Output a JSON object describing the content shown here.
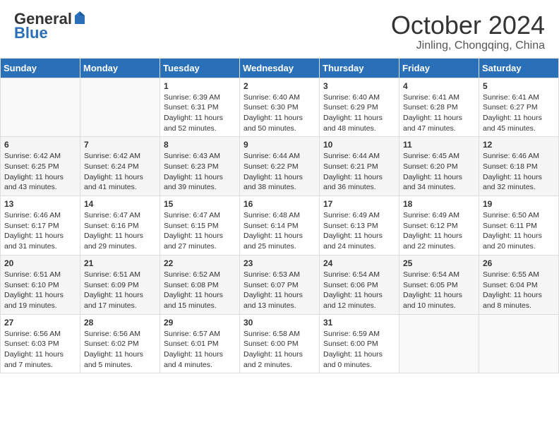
{
  "logo": {
    "general": "General",
    "blue": "Blue"
  },
  "title": "October 2024",
  "subtitle": "Jinling, Chongqing, China",
  "days_of_week": [
    "Sunday",
    "Monday",
    "Tuesday",
    "Wednesday",
    "Thursday",
    "Friday",
    "Saturday"
  ],
  "weeks": [
    [
      {
        "day": "",
        "info": ""
      },
      {
        "day": "",
        "info": ""
      },
      {
        "day": "1",
        "info": "Sunrise: 6:39 AM\nSunset: 6:31 PM\nDaylight: 11 hours and 52 minutes."
      },
      {
        "day": "2",
        "info": "Sunrise: 6:40 AM\nSunset: 6:30 PM\nDaylight: 11 hours and 50 minutes."
      },
      {
        "day": "3",
        "info": "Sunrise: 6:40 AM\nSunset: 6:29 PM\nDaylight: 11 hours and 48 minutes."
      },
      {
        "day": "4",
        "info": "Sunrise: 6:41 AM\nSunset: 6:28 PM\nDaylight: 11 hours and 47 minutes."
      },
      {
        "day": "5",
        "info": "Sunrise: 6:41 AM\nSunset: 6:27 PM\nDaylight: 11 hours and 45 minutes."
      }
    ],
    [
      {
        "day": "6",
        "info": "Sunrise: 6:42 AM\nSunset: 6:25 PM\nDaylight: 11 hours and 43 minutes."
      },
      {
        "day": "7",
        "info": "Sunrise: 6:42 AM\nSunset: 6:24 PM\nDaylight: 11 hours and 41 minutes."
      },
      {
        "day": "8",
        "info": "Sunrise: 6:43 AM\nSunset: 6:23 PM\nDaylight: 11 hours and 39 minutes."
      },
      {
        "day": "9",
        "info": "Sunrise: 6:44 AM\nSunset: 6:22 PM\nDaylight: 11 hours and 38 minutes."
      },
      {
        "day": "10",
        "info": "Sunrise: 6:44 AM\nSunset: 6:21 PM\nDaylight: 11 hours and 36 minutes."
      },
      {
        "day": "11",
        "info": "Sunrise: 6:45 AM\nSunset: 6:20 PM\nDaylight: 11 hours and 34 minutes."
      },
      {
        "day": "12",
        "info": "Sunrise: 6:46 AM\nSunset: 6:18 PM\nDaylight: 11 hours and 32 minutes."
      }
    ],
    [
      {
        "day": "13",
        "info": "Sunrise: 6:46 AM\nSunset: 6:17 PM\nDaylight: 11 hours and 31 minutes."
      },
      {
        "day": "14",
        "info": "Sunrise: 6:47 AM\nSunset: 6:16 PM\nDaylight: 11 hours and 29 minutes."
      },
      {
        "day": "15",
        "info": "Sunrise: 6:47 AM\nSunset: 6:15 PM\nDaylight: 11 hours and 27 minutes."
      },
      {
        "day": "16",
        "info": "Sunrise: 6:48 AM\nSunset: 6:14 PM\nDaylight: 11 hours and 25 minutes."
      },
      {
        "day": "17",
        "info": "Sunrise: 6:49 AM\nSunset: 6:13 PM\nDaylight: 11 hours and 24 minutes."
      },
      {
        "day": "18",
        "info": "Sunrise: 6:49 AM\nSunset: 6:12 PM\nDaylight: 11 hours and 22 minutes."
      },
      {
        "day": "19",
        "info": "Sunrise: 6:50 AM\nSunset: 6:11 PM\nDaylight: 11 hours and 20 minutes."
      }
    ],
    [
      {
        "day": "20",
        "info": "Sunrise: 6:51 AM\nSunset: 6:10 PM\nDaylight: 11 hours and 19 minutes."
      },
      {
        "day": "21",
        "info": "Sunrise: 6:51 AM\nSunset: 6:09 PM\nDaylight: 11 hours and 17 minutes."
      },
      {
        "day": "22",
        "info": "Sunrise: 6:52 AM\nSunset: 6:08 PM\nDaylight: 11 hours and 15 minutes."
      },
      {
        "day": "23",
        "info": "Sunrise: 6:53 AM\nSunset: 6:07 PM\nDaylight: 11 hours and 13 minutes."
      },
      {
        "day": "24",
        "info": "Sunrise: 6:54 AM\nSunset: 6:06 PM\nDaylight: 11 hours and 12 minutes."
      },
      {
        "day": "25",
        "info": "Sunrise: 6:54 AM\nSunset: 6:05 PM\nDaylight: 11 hours and 10 minutes."
      },
      {
        "day": "26",
        "info": "Sunrise: 6:55 AM\nSunset: 6:04 PM\nDaylight: 11 hours and 8 minutes."
      }
    ],
    [
      {
        "day": "27",
        "info": "Sunrise: 6:56 AM\nSunset: 6:03 PM\nDaylight: 11 hours and 7 minutes."
      },
      {
        "day": "28",
        "info": "Sunrise: 6:56 AM\nSunset: 6:02 PM\nDaylight: 11 hours and 5 minutes."
      },
      {
        "day": "29",
        "info": "Sunrise: 6:57 AM\nSunset: 6:01 PM\nDaylight: 11 hours and 4 minutes."
      },
      {
        "day": "30",
        "info": "Sunrise: 6:58 AM\nSunset: 6:00 PM\nDaylight: 11 hours and 2 minutes."
      },
      {
        "day": "31",
        "info": "Sunrise: 6:59 AM\nSunset: 6:00 PM\nDaylight: 11 hours and 0 minutes."
      },
      {
        "day": "",
        "info": ""
      },
      {
        "day": "",
        "info": ""
      }
    ]
  ]
}
